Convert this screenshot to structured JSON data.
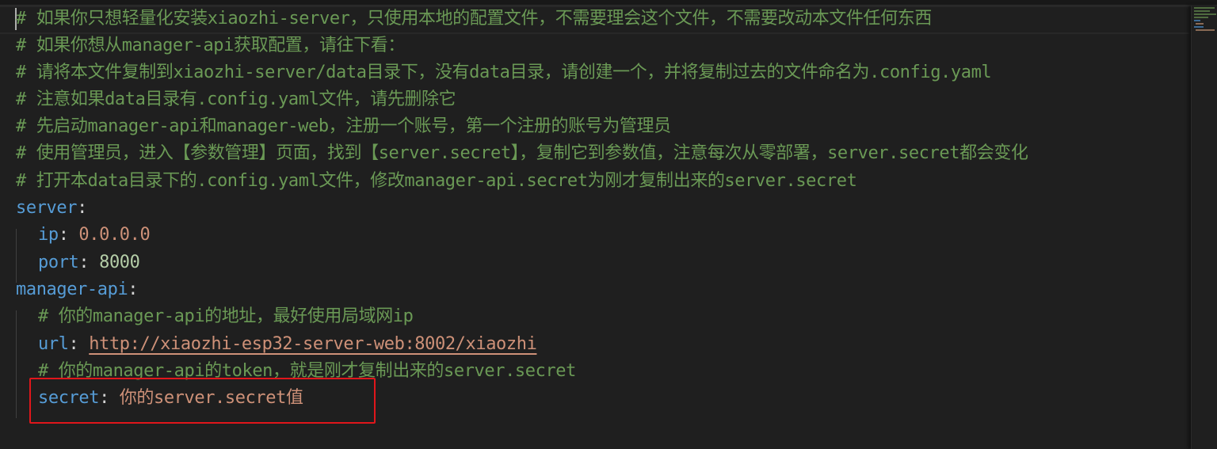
{
  "lines": [
    {
      "comment": "# 如果你只想轻量化安装xiaozhi-server，只使用本地的配置文件，不需要理会这个文件，不需要改动本文件任何东西"
    },
    {
      "comment": "# 如果你想从manager-api获取配置，请往下看："
    },
    {
      "comment": "# 请将本文件复制到xiaozhi-server/data目录下，没有data目录，请创建一个，并将复制过去的文件命名为.config.yaml"
    },
    {
      "comment": "# 注意如果data目录有.config.yaml文件，请先删除它"
    },
    {
      "comment": "# 先启动manager-api和manager-web，注册一个账号，第一个注册的账号为管理员"
    },
    {
      "comment": "# 使用管理员，进入【参数管理】页面，找到【server.secret】，复制它到参数值，注意每次从零部署，server.secret都会变化"
    },
    {
      "comment": "# 打开本data目录下的.config.yaml文件，修改manager-api.secret为刚才复制出来的server.secret"
    },
    {
      "key": "server",
      "colon": ":"
    },
    {
      "key": "ip",
      "colon": ": ",
      "value": "0.0.0.0"
    },
    {
      "key": "port",
      "colon": ": ",
      "value": "8000"
    },
    {
      "key": "manager-api",
      "colon": ":"
    },
    {
      "comment": "# 你的manager-api的地址，最好使用局域网ip"
    },
    {
      "key": "url",
      "colon": ": ",
      "value": "http://xiaozhi-esp32-server-web:8002/xiaozhi"
    },
    {
      "comment": "# 你的manager-api的token，就是刚才复制出来的server.secret"
    },
    {
      "key": "secret",
      "colon": ": ",
      "value": "你的server.secret值"
    }
  ],
  "colors": {
    "comment": "#6a9955",
    "key": "#569cd6",
    "string": "#ce9178",
    "number": "#b5cea8",
    "highlight_box": "#e0161b"
  }
}
